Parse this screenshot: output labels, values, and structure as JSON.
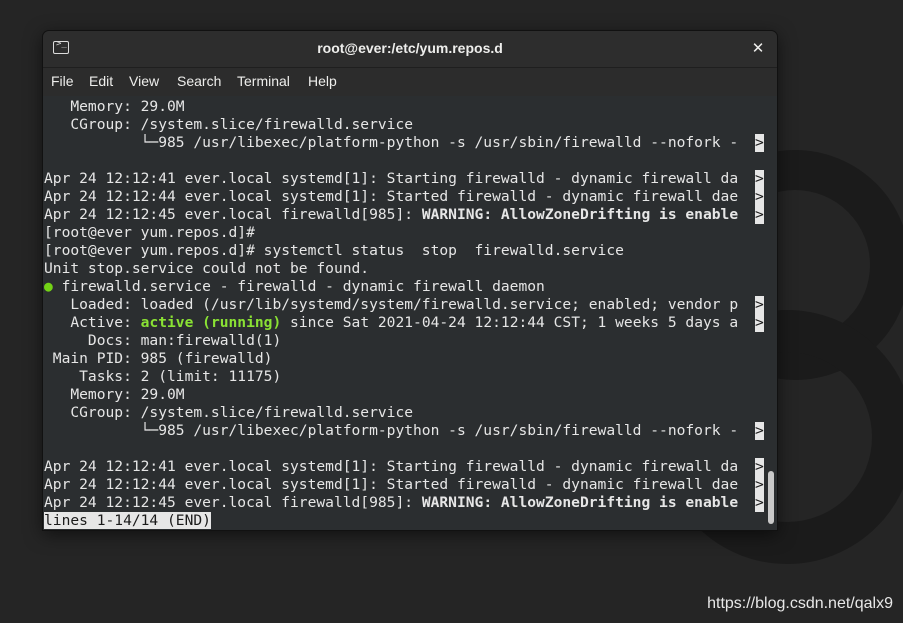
{
  "window": {
    "title": "root@ever:/etc/yum.repos.d",
    "close_glyph": "✕",
    "icon": "terminal-icon",
    "icon_glyph": ">_"
  },
  "menu": [
    "File",
    "Edit",
    "View",
    "Search",
    "Terminal",
    "Help"
  ],
  "terminal": {
    "lines": [
      "   Memory: 29.0M",
      "   CGroup: /system.slice/firewalld.service",
      "           └─985 /usr/libexec/platform-python -s /usr/sbin/firewalld --nofork -",
      "",
      "Apr 24 12:12:41 ever.local systemd[1]: Starting firewalld - dynamic firewall da",
      "Apr 24 12:12:44 ever.local systemd[1]: Started firewalld - dynamic firewall dae",
      "Apr 24 12:12:45 ever.local firewalld[985]: ",
      "[root@ever yum.repos.d]#",
      "[root@ever yum.repos.d]# systemctl status  stop  firewalld.service",
      "Unit stop.service could not be found.",
      " firewalld.service - firewalld - dynamic firewall daemon",
      "   Loaded: loaded (/usr/lib/systemd/system/firewalld.service; enabled; vendor p",
      "   Active: ",
      "     Docs: man:firewalld(1)",
      " Main PID: 985 (firewalld)",
      "    Tasks: 2 (limit: 11175)",
      "   Memory: 29.0M",
      "   CGroup: /system.slice/firewalld.service",
      "           └─985 /usr/libexec/platform-python -s /usr/sbin/firewalld --nofork -",
      "",
      "Apr 24 12:12:41 ever.local systemd[1]: Starting firewalld - dynamic firewall da",
      "Apr 24 12:12:44 ever.local systemd[1]: Started firewalld - dynamic firewall dae",
      "Apr 24 12:12:45 ever.local firewalld[985]: "
    ],
    "warning_text": "WARNING: AllowZoneDrifting is enable",
    "status_dot": "●",
    "active_state": "active (running)",
    "active_rest": " since Sat 2021-04-24 12:12:44 CST; 1 weeks 5 days a",
    "truncation_marker": ">",
    "pager_status": "lines 1-14/14 (END)"
  },
  "watermark": "https://blog.csdn.net/qalx9"
}
